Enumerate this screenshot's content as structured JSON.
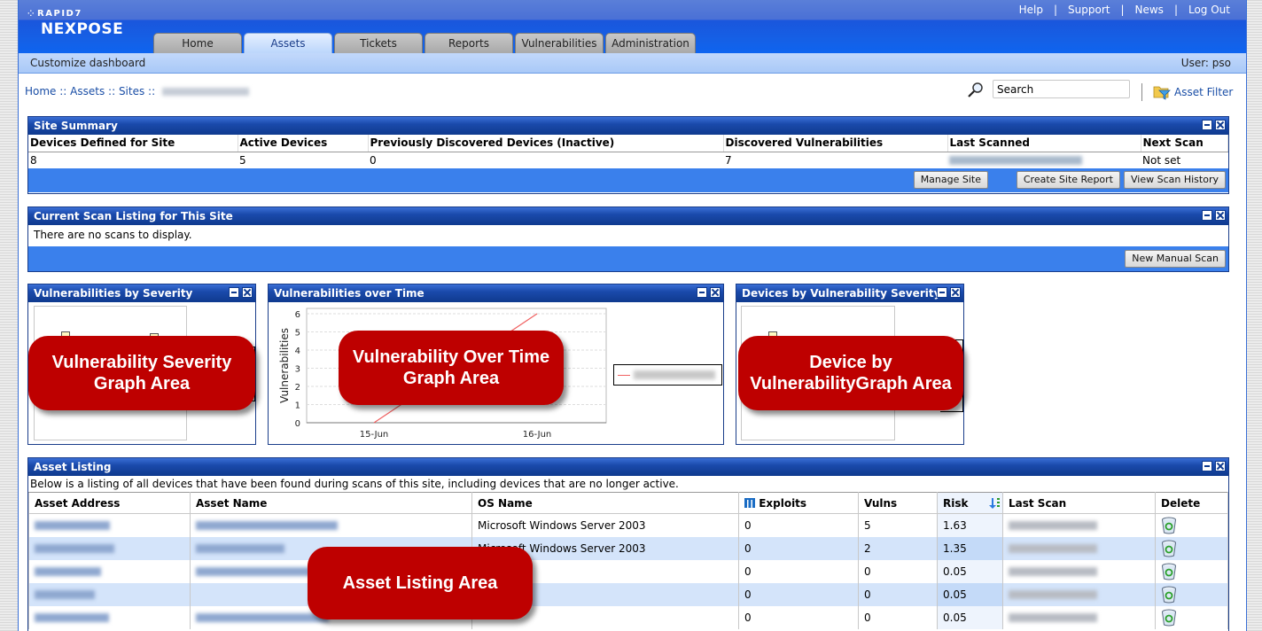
{
  "header": {
    "brand_top": "RAPID7",
    "brand_product": "NEXPOSE",
    "top_links": [
      "Help",
      "Support",
      "News",
      "Log Out"
    ],
    "tabs": [
      {
        "label": "Home",
        "active": false
      },
      {
        "label": "Assets",
        "active": true
      },
      {
        "label": "Tickets",
        "active": false
      },
      {
        "label": "Reports",
        "active": false
      },
      {
        "label": "Vulnerabilities",
        "active": false
      },
      {
        "label": "Administration",
        "active": false
      }
    ],
    "customize_label": "Customize dashboard",
    "user_label": "User: pso"
  },
  "breadcrumb": {
    "items": [
      "Home",
      "Assets",
      "Sites"
    ],
    "separator": " :: "
  },
  "search": {
    "value": "Search",
    "asset_filter_label": "Asset Filter"
  },
  "site_summary": {
    "title": "Site Summary",
    "columns": [
      "Devices Defined for Site",
      "Active Devices",
      "Previously Discovered Devices (Inactive)",
      "Discovered Vulnerabilities",
      "Last Scanned",
      "Next Scan"
    ],
    "values": [
      "8",
      "5",
      "0",
      "7",
      "",
      "Not set"
    ],
    "buttons": [
      "Manage Site",
      "Create Site Report",
      "View Scan History"
    ]
  },
  "scan_listing": {
    "title": "Current Scan Listing for This Site",
    "empty_message": "There are no scans to display.",
    "button": "New Manual Scan"
  },
  "widgets": {
    "severity": {
      "title": "Vulnerabilities by Severity",
      "callout": "Vulnerability Severity Graph Area"
    },
    "over_time": {
      "title": "Vulnerabilities over Time",
      "callout": "Vulnerability Over Time Graph Area"
    },
    "devices": {
      "title": "Devices by Vulnerability Severity",
      "callout": "Device by VulnerabilityGraph Area"
    }
  },
  "chart_data": {
    "type": "line",
    "title": "Vulnerabilities over Time",
    "xlabel": "",
    "ylabel": "Vulnerabilities",
    "x": [
      "15-Jun",
      "16-Jun"
    ],
    "yticks": [
      0,
      1,
      2,
      3,
      4,
      5,
      6
    ],
    "ylim": [
      0,
      6
    ],
    "grid": true,
    "legend_position": "right",
    "series": [
      {
        "name": "",
        "color": "#f06060",
        "values": [
          0,
          6
        ]
      }
    ]
  },
  "asset_listing": {
    "title": "Asset Listing",
    "description": "Below is a listing of all devices that have been found during scans of this site, including devices that are no longer active.",
    "callout": "Asset Listing Area",
    "columns": [
      "Asset Address",
      "Asset Name",
      "OS Name",
      "Exploits",
      "Vulns",
      "Risk",
      "Last Scan",
      "Delete"
    ],
    "rows": [
      {
        "os": "Microsoft Windows Server 2003",
        "exploits": "0",
        "vulns": "5",
        "risk": "1.63"
      },
      {
        "os": "Microsoft Windows Server 2003",
        "exploits": "0",
        "vulns": "2",
        "risk": "1.35"
      },
      {
        "os": "",
        "exploits": "0",
        "vulns": "0",
        "risk": "0.05"
      },
      {
        "os": "",
        "exploits": "0",
        "vulns": "0",
        "risk": "0.05"
      },
      {
        "os": "",
        "exploits": "0",
        "vulns": "0",
        "risk": "0.05"
      }
    ]
  },
  "colors": {
    "header_blue": "#1560e6",
    "panel_title": "#0f3a8e",
    "panel_footer": "#3a80ec",
    "callout_red": "#be0000",
    "row_alt": "#d4e4fa"
  }
}
